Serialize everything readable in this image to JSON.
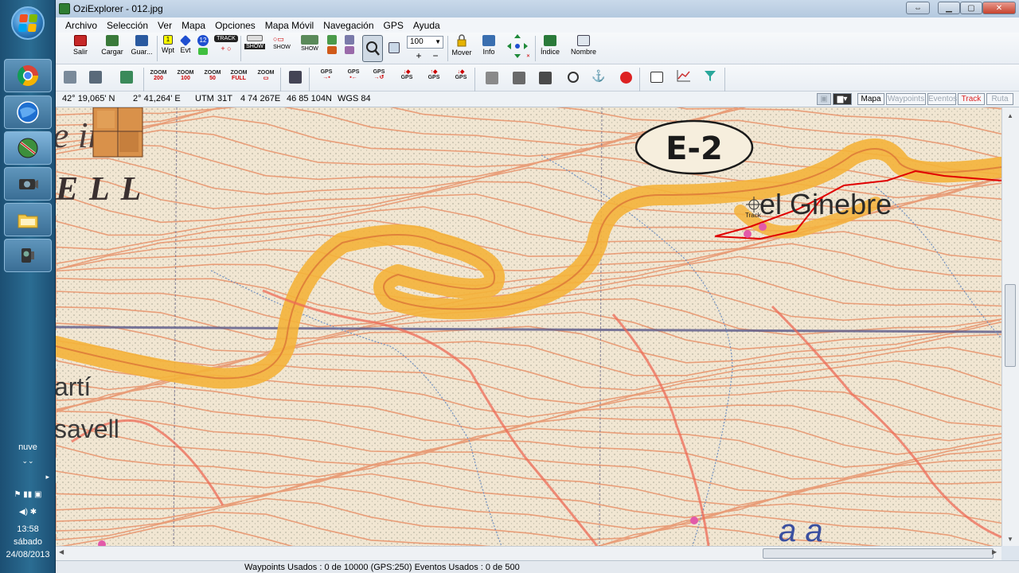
{
  "window": {
    "title": "OziExplorer - 012.jpg"
  },
  "menu": [
    "Archivo",
    "Selección",
    "Ver",
    "Mapa",
    "Opciones",
    "Mapa Móvil",
    "Navegación",
    "GPS",
    "Ayuda"
  ],
  "toolbar": {
    "salir": "Salir",
    "cargar": "Cargar",
    "guardar": "Guar...",
    "wpt": "Wpt",
    "evt": "Evt",
    "track_badge": "TRACK",
    "show1": "SHOW",
    "show2": "SHOW",
    "show3": "SHOW",
    "zoom_value": "100",
    "mover": "Mover",
    "info": "Info",
    "indice": "Índice",
    "nombre": "Nombre"
  },
  "toolbar2": {
    "zoom": "ZOOM",
    "z200": "200",
    "z100": "100",
    "z50": "50",
    "zfull": "FULL",
    "gps": "GPS",
    "waypoint_num": "12",
    "wpt_num": "1"
  },
  "infobar": {
    "lat": "42° 19,065' N",
    "lon": "2° 41,264' E",
    "utm_label": "UTM",
    "utm_zone": "31T",
    "easting": "4 74 267E",
    "northing": "46 85 104N",
    "datum": "WGS 84",
    "modes": [
      "Mapa",
      "Waypoints",
      "Eventos",
      "Track",
      "Ruta"
    ]
  },
  "map": {
    "labels": {
      "e2": "E-2",
      "ginebre": "el Ginebre",
      "track": "Track",
      "ina": "e    ina",
      "ell": "ELL",
      "arti": "artí",
      "savell": "savell",
      "ba": "a a"
    },
    "colors": {
      "paper": "#f1e6d2",
      "contour": "#e8926a",
      "road": "#f4b23a",
      "grid": "#5a5a8a",
      "stream": "#6f8fc0",
      "track": "#e00000",
      "waypoint": "#e25aa9"
    }
  },
  "status": {
    "text": "Waypoints Usados : 0 de 10000  (GPS:250)  Eventos Usados : 0 de 500"
  },
  "taskbar": {
    "weather": "nuve",
    "time": "13:58",
    "day": "sábado",
    "date": "24/08/2013"
  }
}
